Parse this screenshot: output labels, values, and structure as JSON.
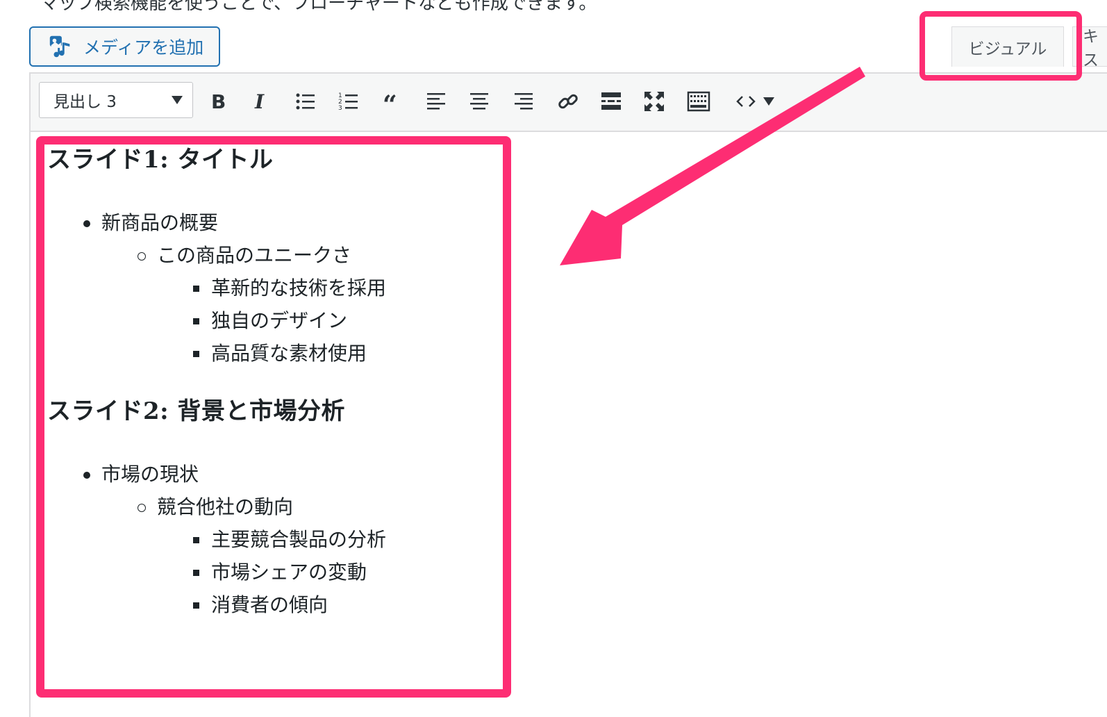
{
  "intro_text": "マップ検索機能を使うことで、フローチャートなども作成できます。",
  "media_button": {
    "label": "メディアを追加",
    "icon": "media-add-icon"
  },
  "tabs": {
    "visual": "ビジュアル",
    "text": "テキスト"
  },
  "toolbar": {
    "format_select": "見出し 3",
    "buttons": [
      "bold-icon",
      "italic-icon",
      "bullet-list-icon",
      "numbered-list-icon",
      "blockquote-icon",
      "align-left-icon",
      "align-center-icon",
      "align-right-icon",
      "link-icon",
      "read-more-icon",
      "fullscreen-icon",
      "toolbar-toggle-icon",
      "code-icon"
    ]
  },
  "content": {
    "slide1": {
      "heading": "スライド1: タイトル",
      "item": "新商品の概要",
      "subitem": "この商品のユニークさ",
      "points": [
        "革新的な技術を採用",
        "独自のデザイン",
        "高品質な素材使用"
      ]
    },
    "slide2": {
      "heading": "スライド2: 背景と市場分析",
      "item": "市場の現状",
      "subitem": "競合他社の動向",
      "points": [
        "主要競合製品の分析",
        "市場シェアの変動",
        "消費者の傾向"
      ]
    }
  },
  "annotation_color": "#fd2d73"
}
